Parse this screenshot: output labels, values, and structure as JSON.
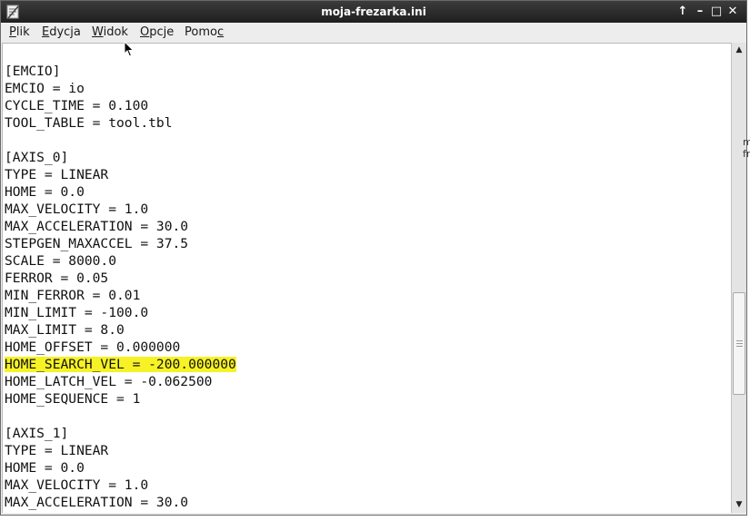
{
  "window": {
    "title": "moja-frezarka.ini",
    "controls": {
      "up": "↑",
      "minimize": "–",
      "maximize": "□",
      "close": "✕"
    }
  },
  "menu": [
    {
      "pre": "",
      "mn": "P",
      "post": "lik"
    },
    {
      "pre": "",
      "mn": "E",
      "post": "dycja"
    },
    {
      "pre": "",
      "mn": "W",
      "post": "idok"
    },
    {
      "pre": "",
      "mn": "O",
      "post": "pcje"
    },
    {
      "pre": "Pomo",
      "mn": "c",
      "post": ""
    }
  ],
  "lines": [
    "",
    "[EMCIO]",
    "EMCIO = io",
    "CYCLE_TIME = 0.100",
    "TOOL_TABLE = tool.tbl",
    "",
    "[AXIS_0]",
    "TYPE = LINEAR",
    "HOME = 0.0",
    "MAX_VELOCITY = 1.0",
    "MAX_ACCELERATION = 30.0",
    "STEPGEN_MAXACCEL = 37.5",
    "SCALE = 8000.0",
    "FERROR = 0.05",
    "MIN_FERROR = 0.01",
    "MIN_LIMIT = -100.0",
    "MAX_LIMIT = 8.0",
    "HOME_OFFSET = 0.000000",
    "HOME_SEARCH_VEL = -200.000000",
    "HOME_LATCH_VEL = -0.062500",
    "HOME_SEQUENCE = 1",
    "",
    "[AXIS_1]",
    "TYPE = LINEAR",
    "HOME = 0.0",
    "MAX_VELOCITY = 1.0",
    "MAX_ACCELERATION = 30.0"
  ],
  "highlighted_line": 18,
  "highlight_color": "#f7f225",
  "scrollbar": {
    "up_arrow": "▲",
    "down_arrow": "▼"
  },
  "background_window_fragments": [
    "m",
    "fr"
  ]
}
